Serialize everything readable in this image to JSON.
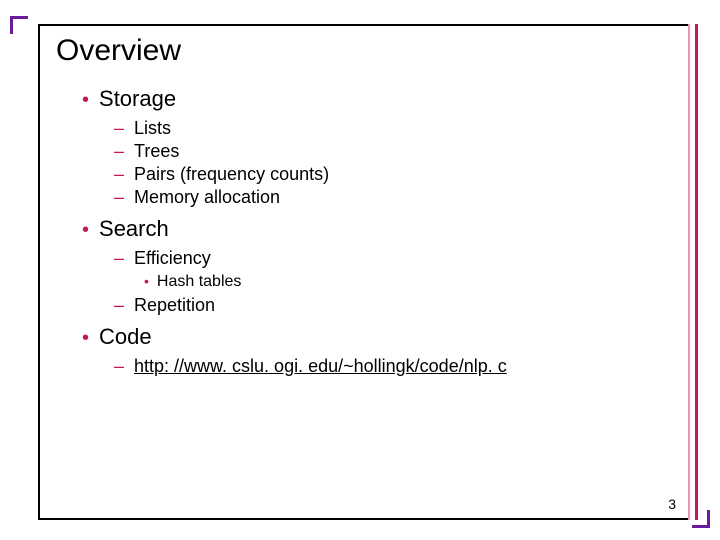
{
  "title": "Overview",
  "bullets": [
    {
      "label": "Storage",
      "children": [
        {
          "label": "Lists"
        },
        {
          "label": "Trees"
        },
        {
          "label": "Pairs (frequency counts)"
        },
        {
          "label": "Memory allocation"
        }
      ]
    },
    {
      "label": "Search",
      "children": [
        {
          "label": "Efficiency",
          "children": [
            {
              "label": "Hash tables"
            }
          ]
        },
        {
          "label": "Repetition"
        }
      ]
    },
    {
      "label": "Code",
      "children": [
        {
          "label": " http: //www. cslu. ogi. edu/~hollingk/code/nlp. c",
          "link": true
        }
      ]
    }
  ],
  "page_number": "3",
  "glyphs": {
    "b1": "•",
    "b2": "–",
    "b3": "•"
  }
}
